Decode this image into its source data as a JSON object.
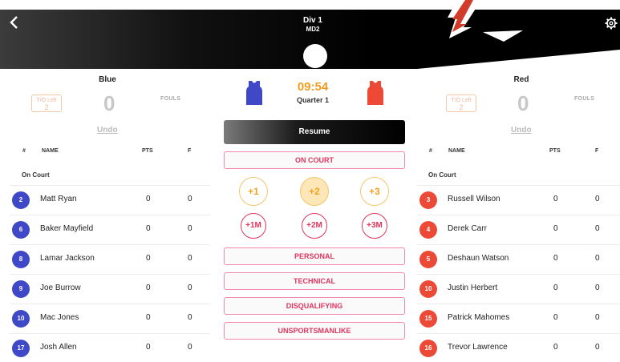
{
  "header": {
    "title": "Div 1",
    "subtitle": "MD2",
    "back_icon": "chevron-left-icon",
    "settings_icon": "gear-icon"
  },
  "game": {
    "clock": "09:54",
    "quarter": "Quarter 1",
    "resume_label": "Resume",
    "on_court_label": "ON COURT",
    "points": [
      "+1",
      "+2",
      "+3"
    ],
    "made_points": [
      "+1M",
      "+2M",
      "+3M"
    ],
    "fouls": [
      "PERSONAL",
      "TECHNICAL",
      "DISQUALIFYING",
      "UNSPORTSMANLIKE"
    ]
  },
  "columns": {
    "num": "#",
    "name": "NAME",
    "pts": "PTS",
    "f": "F"
  },
  "home": {
    "name": "Blue",
    "color": "#3f48c6",
    "timeouts_label": "T/O Left",
    "timeouts": "2",
    "score": "0",
    "fouls_label": "FOULS",
    "undo": "Undo",
    "section": "On Court",
    "players": [
      {
        "num": "2",
        "name": "Matt Ryan",
        "pts": "0",
        "f": "0"
      },
      {
        "num": "6",
        "name": "Baker Mayfield",
        "pts": "0",
        "f": "0"
      },
      {
        "num": "8",
        "name": "Lamar Jackson",
        "pts": "0",
        "f": "0"
      },
      {
        "num": "9",
        "name": "Joe Burrow",
        "pts": "0",
        "f": "0"
      },
      {
        "num": "10",
        "name": "Mac Jones",
        "pts": "0",
        "f": "0"
      },
      {
        "num": "17",
        "name": "Josh Allen",
        "pts": "0",
        "f": "0"
      }
    ]
  },
  "away": {
    "name": "Red",
    "color": "#ec4a36",
    "timeouts_label": "T/O Left",
    "timeouts": "2",
    "score": "0",
    "fouls_label": "FOULS",
    "undo": "Undo",
    "section": "On Court",
    "players": [
      {
        "num": "3",
        "name": "Russell Wilson",
        "pts": "0",
        "f": "0"
      },
      {
        "num": "4",
        "name": "Derek Carr",
        "pts": "0",
        "f": "0"
      },
      {
        "num": "5",
        "name": "Deshaun Watson",
        "pts": "0",
        "f": "0"
      },
      {
        "num": "10",
        "name": "Justin Herbert",
        "pts": "0",
        "f": "0"
      },
      {
        "num": "15",
        "name": "Patrick Mahomes",
        "pts": "0",
        "f": "0"
      },
      {
        "num": "16",
        "name": "Trevor Lawrence",
        "pts": "0",
        "f": "0"
      }
    ]
  }
}
